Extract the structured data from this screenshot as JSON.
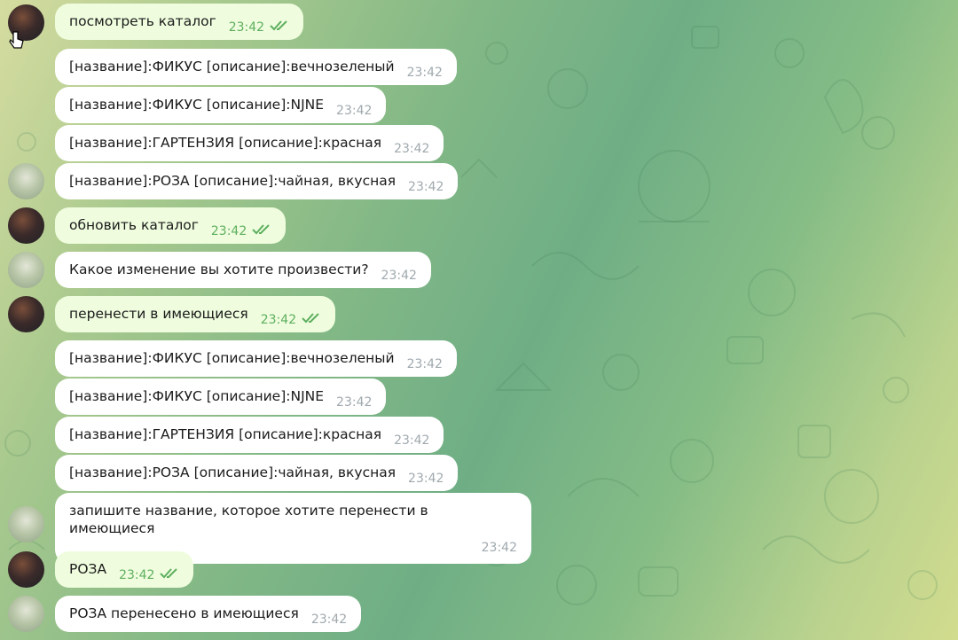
{
  "messages": [
    {
      "text": "посмотреть каталог",
      "time": "23:42",
      "out": true
    },
    {
      "text": "[название]:ФИКУС  [описание]:вечнозеленый",
      "time": "23:42",
      "out": false
    },
    {
      "text": "[название]:ФИКУС  [описание]:NJNE",
      "time": "23:42",
      "out": false
    },
    {
      "text": "[название]:ГАРТЕНЗИЯ  [описание]:красная",
      "time": "23:42",
      "out": false
    },
    {
      "text": "[название]:РОЗА  [описание]:чайная, вкусная",
      "time": "23:42",
      "out": false
    },
    {
      "text": "обновить каталог",
      "time": "23:42",
      "out": true
    },
    {
      "text": "Какое изменение вы хотите произвести?",
      "time": "23:42",
      "out": false
    },
    {
      "text": "перенести в имеющиеся",
      "time": "23:42",
      "out": true
    },
    {
      "text": "[название]:ФИКУС  [описание]:вечнозеленый",
      "time": "23:42",
      "out": false
    },
    {
      "text": "[название]:ФИКУС  [описание]:NJNE",
      "time": "23:42",
      "out": false
    },
    {
      "text": "[название]:ГАРТЕНЗИЯ  [описание]:красная",
      "time": "23:42",
      "out": false
    },
    {
      "text": "[название]:РОЗА  [описание]:чайная, вкусная",
      "time": "23:42",
      "out": false
    },
    {
      "text": "запишите название, которое хотите перенести в имеющиеся",
      "time": "23:42",
      "out": false
    },
    {
      "text": "РОЗА",
      "time": "23:42",
      "out": true
    },
    {
      "text": "РОЗА перенесено в имеющиеся",
      "time": "23:42",
      "out": false
    }
  ],
  "colors": {
    "outgoing_bubble": "#effdde",
    "incoming_bubble": "#ffffff",
    "read_ticks": "#5eaf5f",
    "time_gray": "#a0a9ae"
  },
  "icons": [
    "double-check-icon",
    "pointer-cursor-icon",
    "user-avatar",
    "bot-avatar"
  ]
}
